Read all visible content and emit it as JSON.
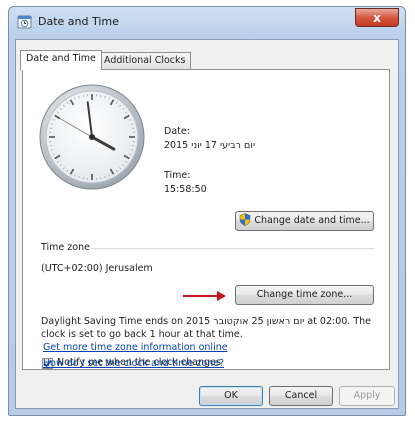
{
  "window": {
    "title": "Date and Time",
    "close_glyph": "x"
  },
  "tabs": [
    {
      "label": "Date and Time"
    },
    {
      "label": "Additional Clocks"
    }
  ],
  "clock": {
    "hour": 15,
    "minute": 58,
    "second": 50
  },
  "date": {
    "label": "Date:",
    "value": "יום רביעי 17 יוני 2015"
  },
  "time": {
    "label": "Time:",
    "value": "15:58:50"
  },
  "buttons": {
    "change_date_time": "Change date and time...",
    "change_time_zone": "Change time zone...",
    "ok": "OK",
    "cancel": "Cancel",
    "apply": "Apply"
  },
  "timezone": {
    "group_label": "Time zone",
    "value": "(UTC+02:00) Jerusalem",
    "dst_line1": "Daylight Saving Time ends on יום ראשון 25 אוקטובר 2015 at 02:00. The",
    "dst_line2": "clock is set to go back 1 hour at that time."
  },
  "notify": {
    "label": "Notify me when the clock changes",
    "checked": true
  },
  "links": {
    "more_info": "Get more time zone information online",
    "how_set": "How do I set the clock and time zone?"
  },
  "icons": [
    "clock-app-icon",
    "close-icon",
    "uac-shield-icon",
    "checkmark-icon",
    "red-arrow-annotation"
  ],
  "colors": {
    "accent_link": "#0645ad",
    "annotation_arrow": "#c4161c",
    "close_button": "#d5573f"
  }
}
